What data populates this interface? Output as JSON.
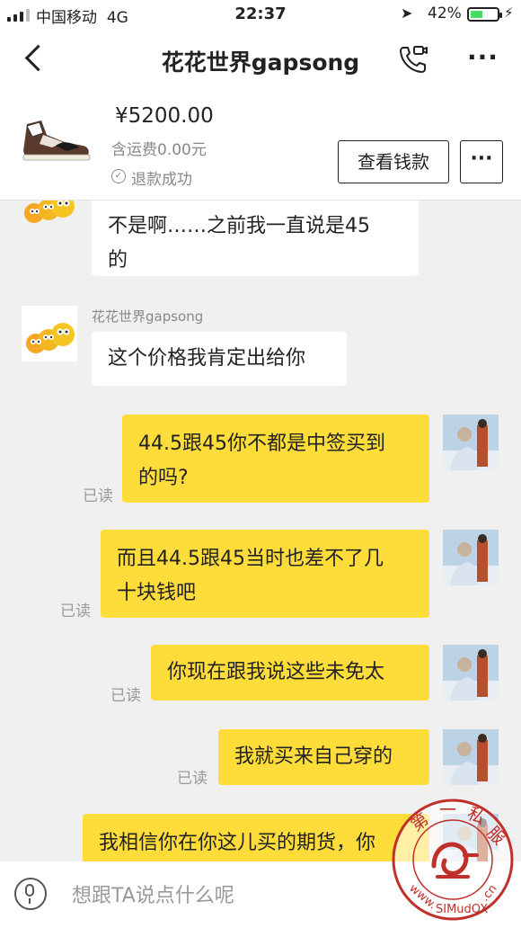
{
  "status_bar": {
    "carrier": "中国移动",
    "network": "4G",
    "time": "22:37",
    "battery_percent": "42%",
    "battery_level": 0.42,
    "battery_color": "#4cd964"
  },
  "nav": {
    "title": "花花世界gapsong",
    "back_icon": "chevron-left-icon",
    "call_icon": "video-call-icon",
    "more_icon": "more-dots-icon"
  },
  "product": {
    "price": "¥5200.00",
    "shipping": "含运费0.00元",
    "status": "退款成功",
    "view_money_label": "查看钱款",
    "more_label": "···"
  },
  "messages": [
    {
      "side": "left",
      "text": "不是啊……之前我一直说是45的",
      "line1": "不是啊……之前我一直说是45",
      "line2": "的"
    },
    {
      "side": "left",
      "sender": "花花世界gapsong",
      "text": "这个价格我肯定出给你"
    },
    {
      "side": "right",
      "read": "已读",
      "line1": "44.5跟45你不都是中签买到",
      "line2": "的吗?"
    },
    {
      "side": "right",
      "read": "已读",
      "line1": "而且44.5跟45当时也差不了几",
      "line2": "十块钱吧"
    },
    {
      "side": "right",
      "read": "已读",
      "text": "你现在跟我说这些未免太"
    },
    {
      "side": "right",
      "read": "已读",
      "text": "我就买来自己穿的"
    },
    {
      "side": "right",
      "text": "我相信你在你这儿买的期货，你"
    }
  ],
  "input": {
    "placeholder": "想跟TA说点什么呢",
    "mic_icon": "microphone-icon"
  },
  "watermark": {
    "text_top": "第一私服",
    "text_bottom": "www.SIMudOX.cn",
    "color": "#c0302a"
  },
  "colors": {
    "bubble_right": "#fedd3a",
    "bubble_left": "#ffffff",
    "chat_bg": "#f0f0f0"
  }
}
